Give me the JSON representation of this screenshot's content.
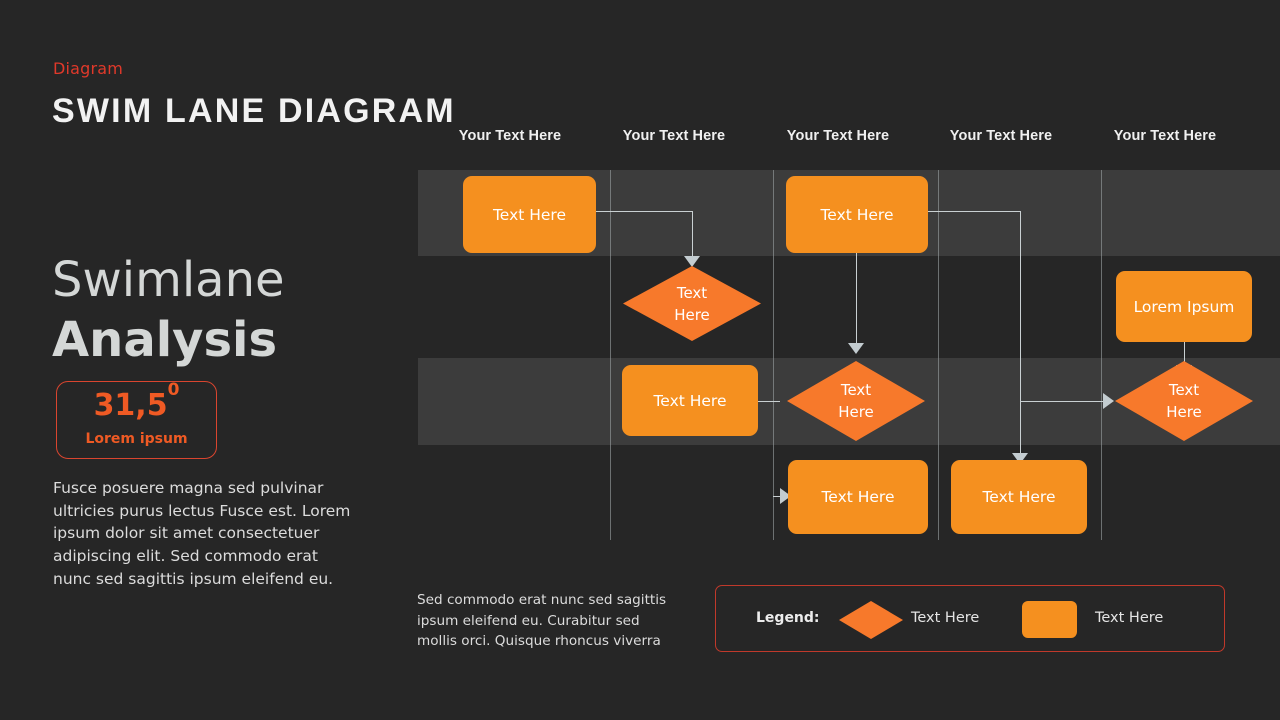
{
  "header": {
    "kicker": "Diagram",
    "title": "SWIM LANE DIAGRAM"
  },
  "left_panel": {
    "title_line1": "Swimlane",
    "title_line2": "Analysis",
    "badge": {
      "value": "31,5",
      "superscript": "0",
      "caption": "Lorem ipsum"
    },
    "paragraph": "Fusce posuere magna sed pulvinar ultricies purus lectus Fusce est. Lorem ipsum dolor sit amet consectetuer adipiscing elit. Sed commodo erat nunc sed sagittis ipsum eleifend eu."
  },
  "diagram": {
    "column_headers": [
      "Your Text Here",
      "Your Text Here",
      "Your Text Here",
      "Your Text Here",
      "Your Text Here"
    ],
    "lanes": [
      {
        "index": 0,
        "nodes": [
          {
            "id": "n1",
            "shape": "rect",
            "label": "Text Here"
          },
          {
            "id": "n2",
            "shape": "rect",
            "label": "Text Here"
          },
          {
            "id": "n3",
            "shape": "rect",
            "label": "Lorem Ipsum"
          }
        ]
      },
      {
        "index": 1,
        "nodes": [
          {
            "id": "d1",
            "shape": "diamond",
            "label_line1": "Text",
            "label_line2": "Here"
          }
        ]
      },
      {
        "index": 2,
        "nodes": [
          {
            "id": "n4",
            "shape": "rect",
            "label": "Text Here"
          },
          {
            "id": "d2",
            "shape": "diamond",
            "label_line1": "Text",
            "label_line2": "Here"
          },
          {
            "id": "d3",
            "shape": "diamond",
            "label_line1": "Text",
            "label_line2": "Here"
          }
        ]
      },
      {
        "index": 3,
        "nodes": [
          {
            "id": "n5",
            "shape": "rect",
            "label": "Text Here"
          },
          {
            "id": "n6",
            "shape": "rect",
            "label": "Text Here"
          }
        ]
      }
    ]
  },
  "bottom": {
    "paragraph": "Sed commodo erat nunc sed sagittis ipsum eleifend eu. Curabitur sed mollis orci. Quisque rhoncus viverra",
    "legend": {
      "label": "Legend:",
      "item_diamond_text": "Text Here",
      "item_rect_text": "Text Here"
    }
  },
  "colors": {
    "background": "#262626",
    "lane_band": "#3c3c3c",
    "node_orange": "#f5901f",
    "diamond_orange": "#f7792b",
    "accent_red": "#e0392a",
    "connector": "#c9d0d2",
    "title_text": "#f2f2f2"
  }
}
